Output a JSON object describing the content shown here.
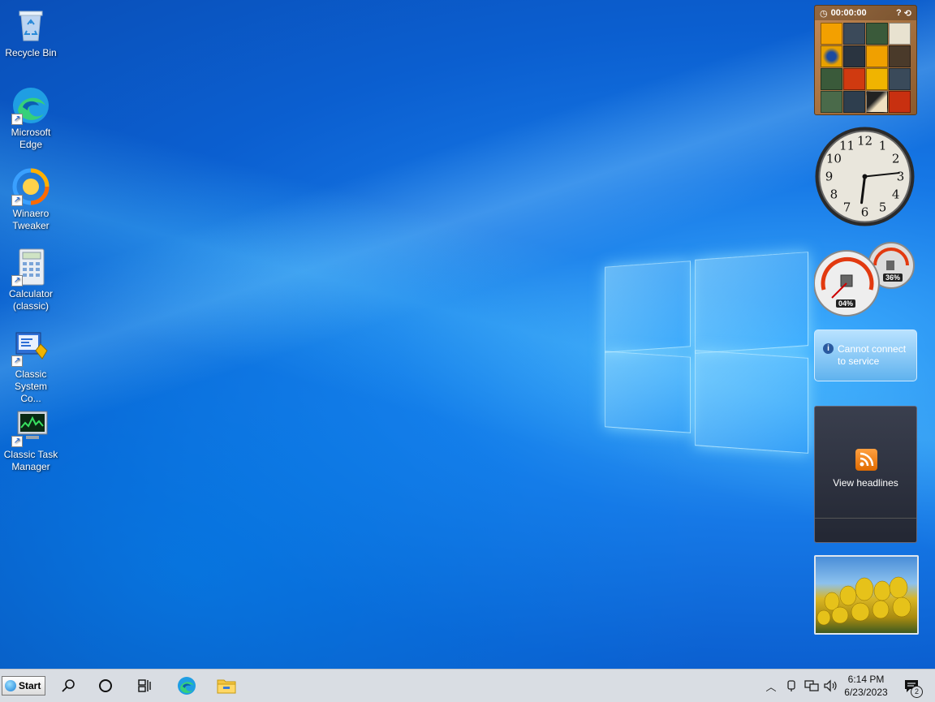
{
  "desktop": {
    "icons": [
      {
        "label": "Recycle Bin",
        "icon": "recycle-bin-icon"
      },
      {
        "label": "Microsoft Edge",
        "icon": "edge-icon"
      },
      {
        "label": "Winaero Tweaker",
        "icon": "winaero-tweaker-icon"
      },
      {
        "label": "Calculator (classic)",
        "icon": "calculator-icon"
      },
      {
        "label": "Classic System Co...",
        "icon": "system-config-icon"
      },
      {
        "label": "Classic Task Manager",
        "icon": "task-manager-icon"
      }
    ]
  },
  "gadgets": {
    "puzzle": {
      "timer": "00:00:00"
    },
    "clock": {
      "hour": 6,
      "minute": 14,
      "numerals": [
        "12",
        "1",
        "2",
        "3",
        "4",
        "5",
        "6",
        "7",
        "8",
        "9",
        "10",
        "11"
      ]
    },
    "cpu_meter": {
      "cpu": "04%",
      "memory": "36%"
    },
    "weather": {
      "message_line1": "Cannot connect",
      "message_line2": "to service"
    },
    "feed": {
      "label": "View headlines"
    }
  },
  "taskbar": {
    "start_label": "Start",
    "time": "6:14 PM",
    "date": "6/23/2023",
    "notification_count": "2"
  },
  "colors": {
    "accent": "#0a5fd0",
    "taskbar_bg": "#d9dde3"
  }
}
